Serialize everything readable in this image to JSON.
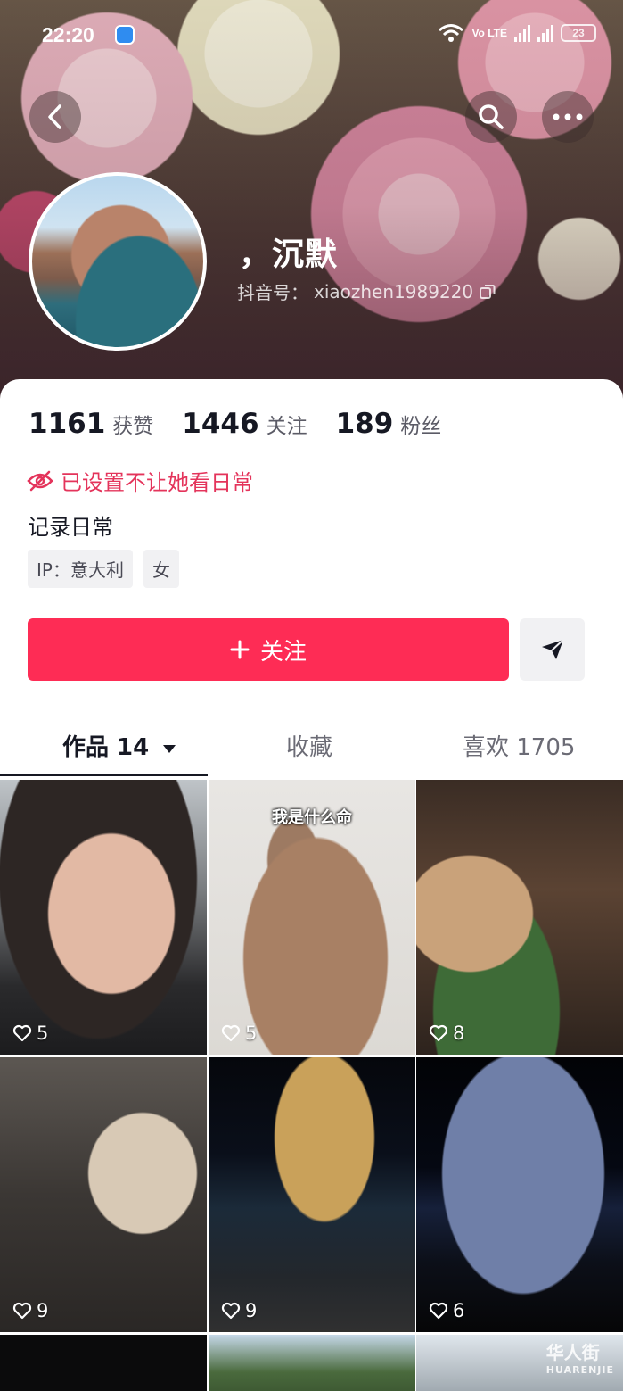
{
  "status_bar": {
    "time": "22:20",
    "network": "Vo LTE",
    "battery": "23"
  },
  "profile": {
    "nickname": "，沉默",
    "handle_label": "抖音号：",
    "handle_value": "xiaozhen1989220"
  },
  "stats": [
    {
      "value": "1161",
      "label": "获赞"
    },
    {
      "value": "1446",
      "label": "关注"
    },
    {
      "value": "189",
      "label": "粉丝"
    }
  ],
  "privacy_notice": "已设置不让她看日常",
  "bio": "记录日常",
  "tags": [
    "IP：意大利",
    "女"
  ],
  "actions": {
    "follow_label": "关注",
    "follow_icon": "plus-icon",
    "share_icon": "send-icon"
  },
  "tabs": [
    {
      "label": "作品 14",
      "active": true
    },
    {
      "label": "收藏",
      "active": false
    },
    {
      "label": "喜欢 1705",
      "active": false
    }
  ],
  "videos": [
    {
      "likes": "5",
      "caption": ""
    },
    {
      "likes": "5",
      "caption": "我是什么命"
    },
    {
      "likes": "8",
      "caption": ""
    },
    {
      "likes": "9",
      "caption": ""
    },
    {
      "likes": "9",
      "caption": ""
    },
    {
      "likes": "6",
      "caption": ""
    }
  ],
  "watermark": {
    "text": "华人街",
    "sub": "HUARENJIE"
  },
  "colors": {
    "accent": "#fe2c55",
    "privacy": "#e4345b",
    "text": "#161823"
  }
}
